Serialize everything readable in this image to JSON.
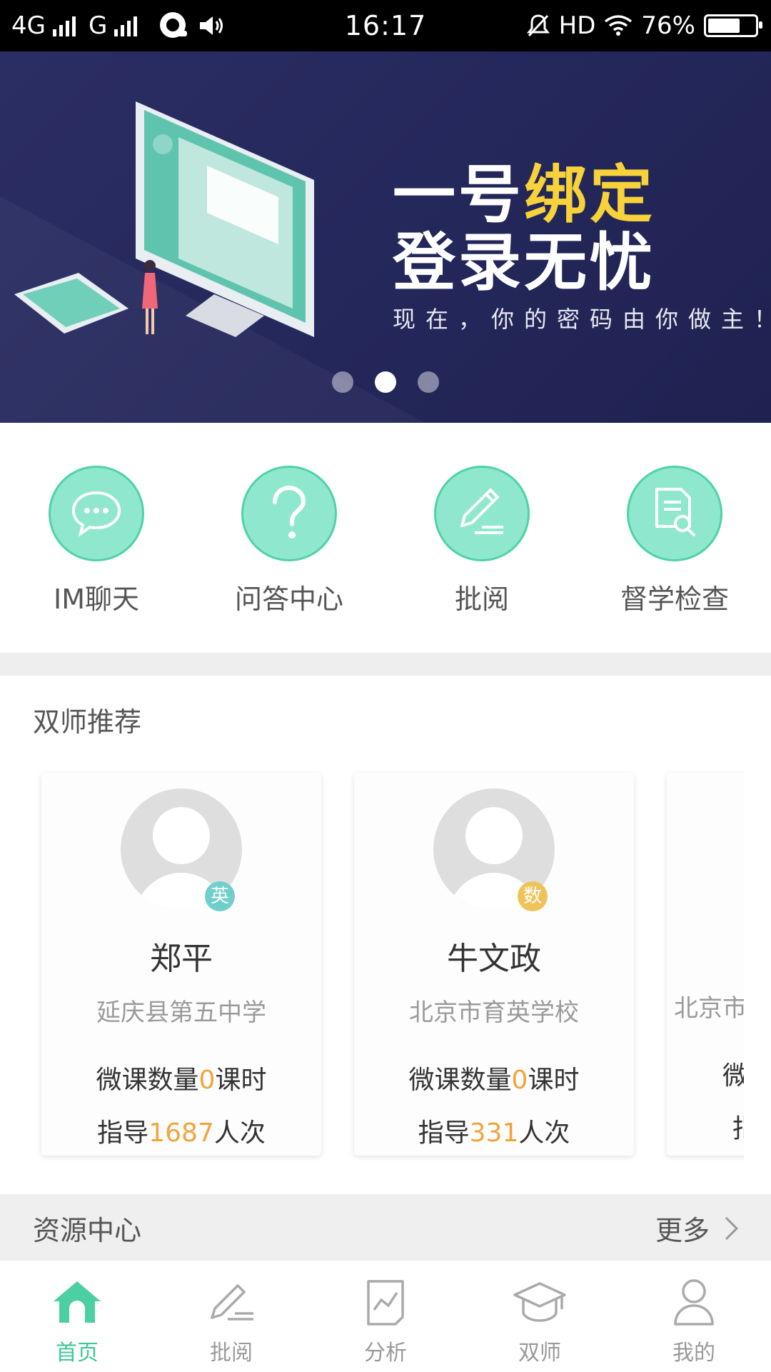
{
  "status_bar": {
    "network1": "4G",
    "network2": "G",
    "time": "16:17",
    "hd": "HD",
    "battery": "76%",
    "battery_level": 0.76
  },
  "banner": {
    "title_part1": "一号",
    "title_highlight": "绑定",
    "title_line2": "登录无忧",
    "subtitle": "现在，你的密码由你做主！",
    "slide_count": 3,
    "active_slide": 2
  },
  "quick_actions": [
    {
      "label": "IM聊天",
      "icon": "chat-bubble-icon"
    },
    {
      "label": "问答中心",
      "icon": "question-mark-icon"
    },
    {
      "label": "批阅",
      "icon": "pencil-edit-icon"
    },
    {
      "label": "督学检查",
      "icon": "document-search-icon"
    }
  ],
  "recommend": {
    "title": "双师推荐",
    "cards": [
      {
        "name": "郑平",
        "school": "延庆县第五中学",
        "subject": "英",
        "subject_color": "#6fcfca",
        "stat1_prefix": "微课数量",
        "stat1_value": "0",
        "stat1_suffix": "课时",
        "stat2_prefix": "指导",
        "stat2_value": "1687",
        "stat2_suffix": "人次"
      },
      {
        "name": "牛文政",
        "school": "北京市育英学校",
        "subject": "数",
        "subject_color": "#f0c35a",
        "stat1_prefix": "微课数量",
        "stat1_value": "0",
        "stat1_suffix": "课时",
        "stat2_prefix": "指导",
        "stat2_value": "331",
        "stat2_suffix": "人次"
      },
      {
        "school": "北京市",
        "stat1_prefix": "微",
        "stat2_prefix": "指"
      }
    ]
  },
  "resources": {
    "title": "资源中心",
    "more": "更多"
  },
  "bottom_nav": [
    {
      "label": "首页",
      "icon": "home-icon",
      "active": true
    },
    {
      "label": "批阅",
      "icon": "pencil-icon",
      "active": false
    },
    {
      "label": "分析",
      "icon": "chart-icon",
      "active": false
    },
    {
      "label": "双师",
      "icon": "graduation-cap-icon",
      "active": false
    },
    {
      "label": "我的",
      "icon": "person-icon",
      "active": false
    }
  ],
  "colors": {
    "accent": "#3fc79a",
    "icon_fill": "#8fe8cd",
    "number_highlight": "#f2a33a",
    "banner_bg": "#2b2e63",
    "banner_highlight": "#f7d23a"
  }
}
